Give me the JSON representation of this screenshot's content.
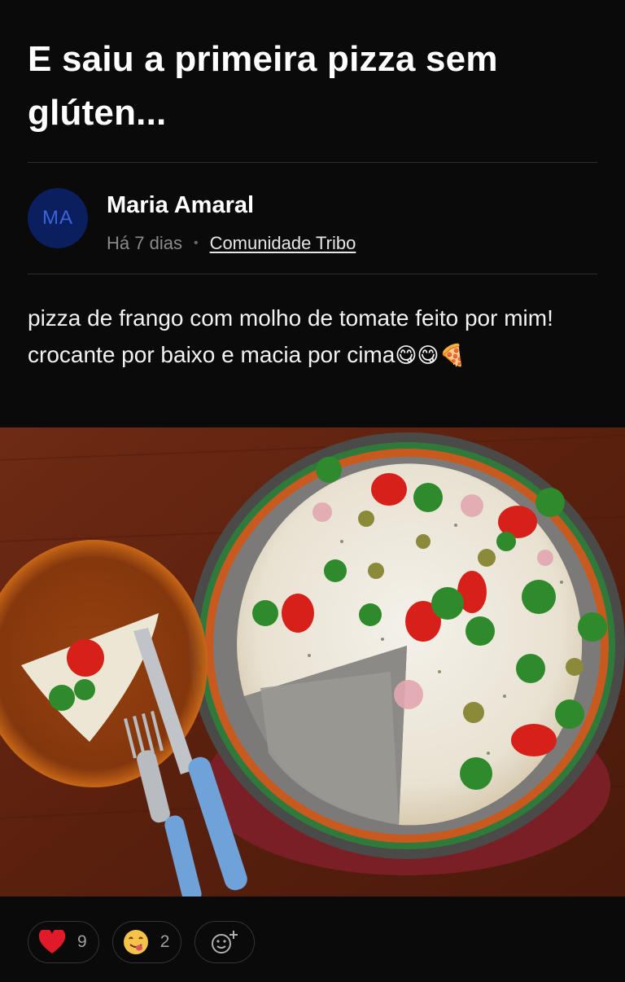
{
  "post": {
    "title": "E saiu a primeira pizza sem glúten...",
    "author": {
      "initials": "MA",
      "name": "Maria Amaral",
      "time": "Há 7 dias",
      "separator": "•",
      "community": "Comunidade Tribo"
    },
    "body": {
      "line1": "pizza de frango com molho de tomate feito por mim!",
      "line2": "crocante por baixo e macia por cima",
      "line2_emojis": "😋😋🍕"
    },
    "image": {
      "subject": "pizza-photo"
    }
  },
  "reactions": [
    {
      "icon": "heart-icon",
      "emoji": "❤",
      "count": "9"
    },
    {
      "icon": "yum-face-icon",
      "emoji": "😋",
      "count": "2"
    }
  ],
  "add_reaction": {
    "icon": "add-reaction-icon"
  },
  "colors": {
    "background": "#0a0a0a",
    "avatar_bg": "#0b1f5e",
    "avatar_text": "#3a63d8",
    "heart": "#e0192b"
  }
}
